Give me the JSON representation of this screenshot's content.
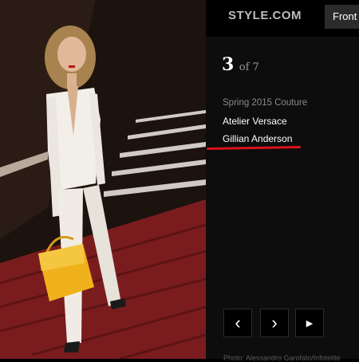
{
  "header": {
    "logo": "STYLE.COM",
    "front_button": "Front R"
  },
  "slide": {
    "current": "3",
    "total_label": "of 7"
  },
  "caption": {
    "season": "Spring 2015 Couture",
    "designer": "Atelier Versace",
    "celebrity": "Gillian Anderson"
  },
  "controls": {
    "prev": "‹",
    "next": "›",
    "play": "▶"
  },
  "credit": "Photo: Alessandro Garofalo/Infotelite",
  "colors": {
    "accent": "#d9141a",
    "bag": "#f0b21c",
    "suit": "#f2eee8"
  }
}
